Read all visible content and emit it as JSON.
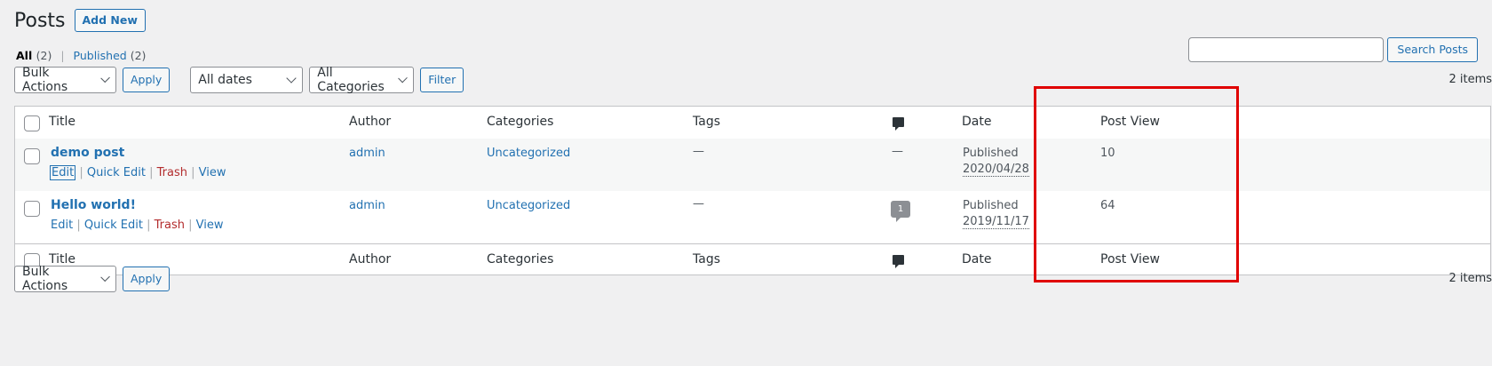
{
  "header": {
    "title": "Posts",
    "add_new": "Add New"
  },
  "filters": {
    "all_label": "All",
    "all_count": "(2)",
    "published_label": "Published",
    "published_count": "(2)",
    "separator": "|"
  },
  "search": {
    "value": "",
    "button": "Search Posts"
  },
  "tablenav_top": {
    "bulk_actions": "Bulk Actions",
    "apply": "Apply",
    "dates": "All dates",
    "categories": "All Categories",
    "filter": "Filter",
    "items": "2 items"
  },
  "tablenav_bottom": {
    "bulk_actions": "Bulk Actions",
    "apply": "Apply",
    "items": "2 items"
  },
  "columns": {
    "title": "Title",
    "author": "Author",
    "categories": "Categories",
    "tags": "Tags",
    "comments_icon": "comment-icon",
    "date": "Date",
    "post_view": "Post View"
  },
  "posts": [
    {
      "title": "demo post",
      "author": "admin",
      "categories": "Uncategorized",
      "tags": "—",
      "comments": "—",
      "status": "Published",
      "date": "2020/04/28",
      "views": "10",
      "actions": {
        "edit": "Edit",
        "quick_edit": "Quick Edit",
        "trash": "Trash",
        "view": "View",
        "sep": "|"
      }
    },
    {
      "title": "Hello world!",
      "author": "admin",
      "categories": "Uncategorized",
      "tags": "—",
      "comments": "1",
      "status": "Published",
      "date": "2019/11/17",
      "views": "64",
      "actions": {
        "edit": "Edit",
        "quick_edit": "Quick Edit",
        "trash": "Trash",
        "view": "View",
        "sep": "|"
      }
    }
  ],
  "colors": {
    "link": "#2271b1",
    "trash": "#b32d2e",
    "highlight": "#e00000",
    "background": "#f0f0f1"
  }
}
